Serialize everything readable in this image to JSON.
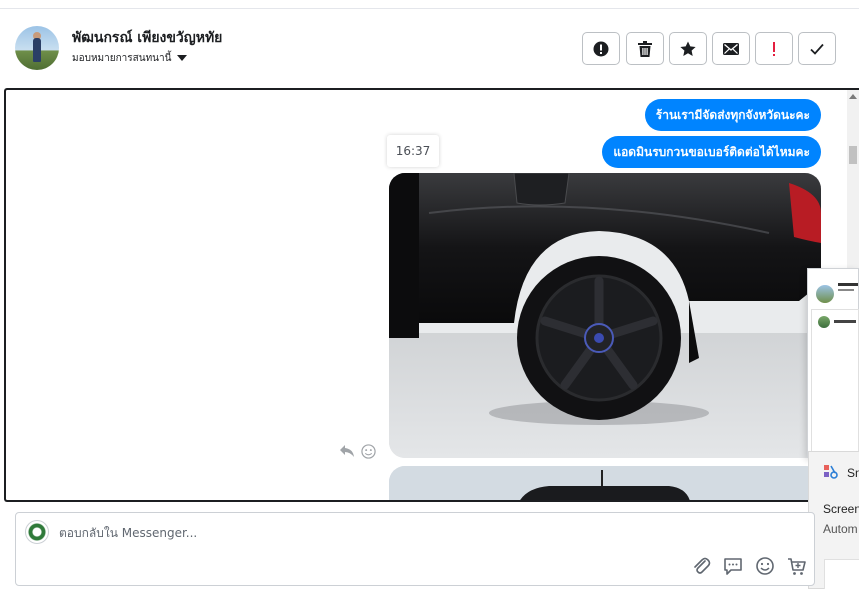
{
  "header": {
    "contact_name": "พัฒนกรณ์ เพียงขวัญหทัย",
    "assign_label": "มอบหมายการสนทนานี้"
  },
  "toolbar": {
    "buttons": [
      {
        "icon": "exclamation-circle-icon"
      },
      {
        "icon": "trash-icon"
      },
      {
        "icon": "star-icon"
      },
      {
        "icon": "envelope-icon"
      },
      {
        "icon": "exclamation-icon",
        "color": "#e41e3f"
      },
      {
        "icon": "checkmark-icon"
      }
    ]
  },
  "chat": {
    "messages": [
      {
        "text": "ร้านเรามีจัดส่งทุกจังหวัดนะคะ"
      },
      {
        "text": "แอดมินรบกวนขอเบอร์ติดต่อได้ไหมคะ"
      }
    ],
    "timestamp": "16:37",
    "accent": "#0084ff"
  },
  "notification": {
    "app_label": "Sn",
    "line1": "Screen",
    "line2": "Autom"
  },
  "composer": {
    "placeholder": "ตอบกลับใน Messenger..."
  }
}
